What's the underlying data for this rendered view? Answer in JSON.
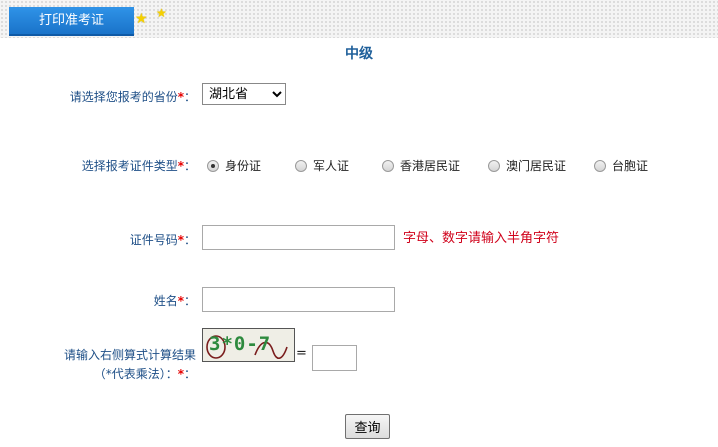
{
  "header": {
    "tab_label": "打印准考证"
  },
  "page": {
    "title": "中级"
  },
  "form": {
    "province": {
      "label": "请选择您报考的省份",
      "selected": "湖北省"
    },
    "id_type": {
      "label": "选择报考证件类型",
      "options": [
        "身份证",
        "军人证",
        "香港居民证",
        "澳门居民证",
        "台胞证"
      ],
      "selected_index": 0
    },
    "id_number": {
      "label": "证件号码",
      "value": "",
      "hint": "字母、数字请输入半角字符"
    },
    "name": {
      "label": "姓名",
      "value": ""
    },
    "captcha": {
      "label_line1": "请输入右侧算式计算结果",
      "label_line2": "（*代表乘法）：",
      "image_text": "3*0-7",
      "equals": "=",
      "value": ""
    },
    "required_mark": "*",
    "label_colon": "：",
    "submit_label": "查询"
  },
  "colors": {
    "tab_bg": "#1a73c9",
    "label": "#1e4f87",
    "required": "#e60000",
    "hint": "#d0021b",
    "captcha_text": "#2d8a3e"
  }
}
